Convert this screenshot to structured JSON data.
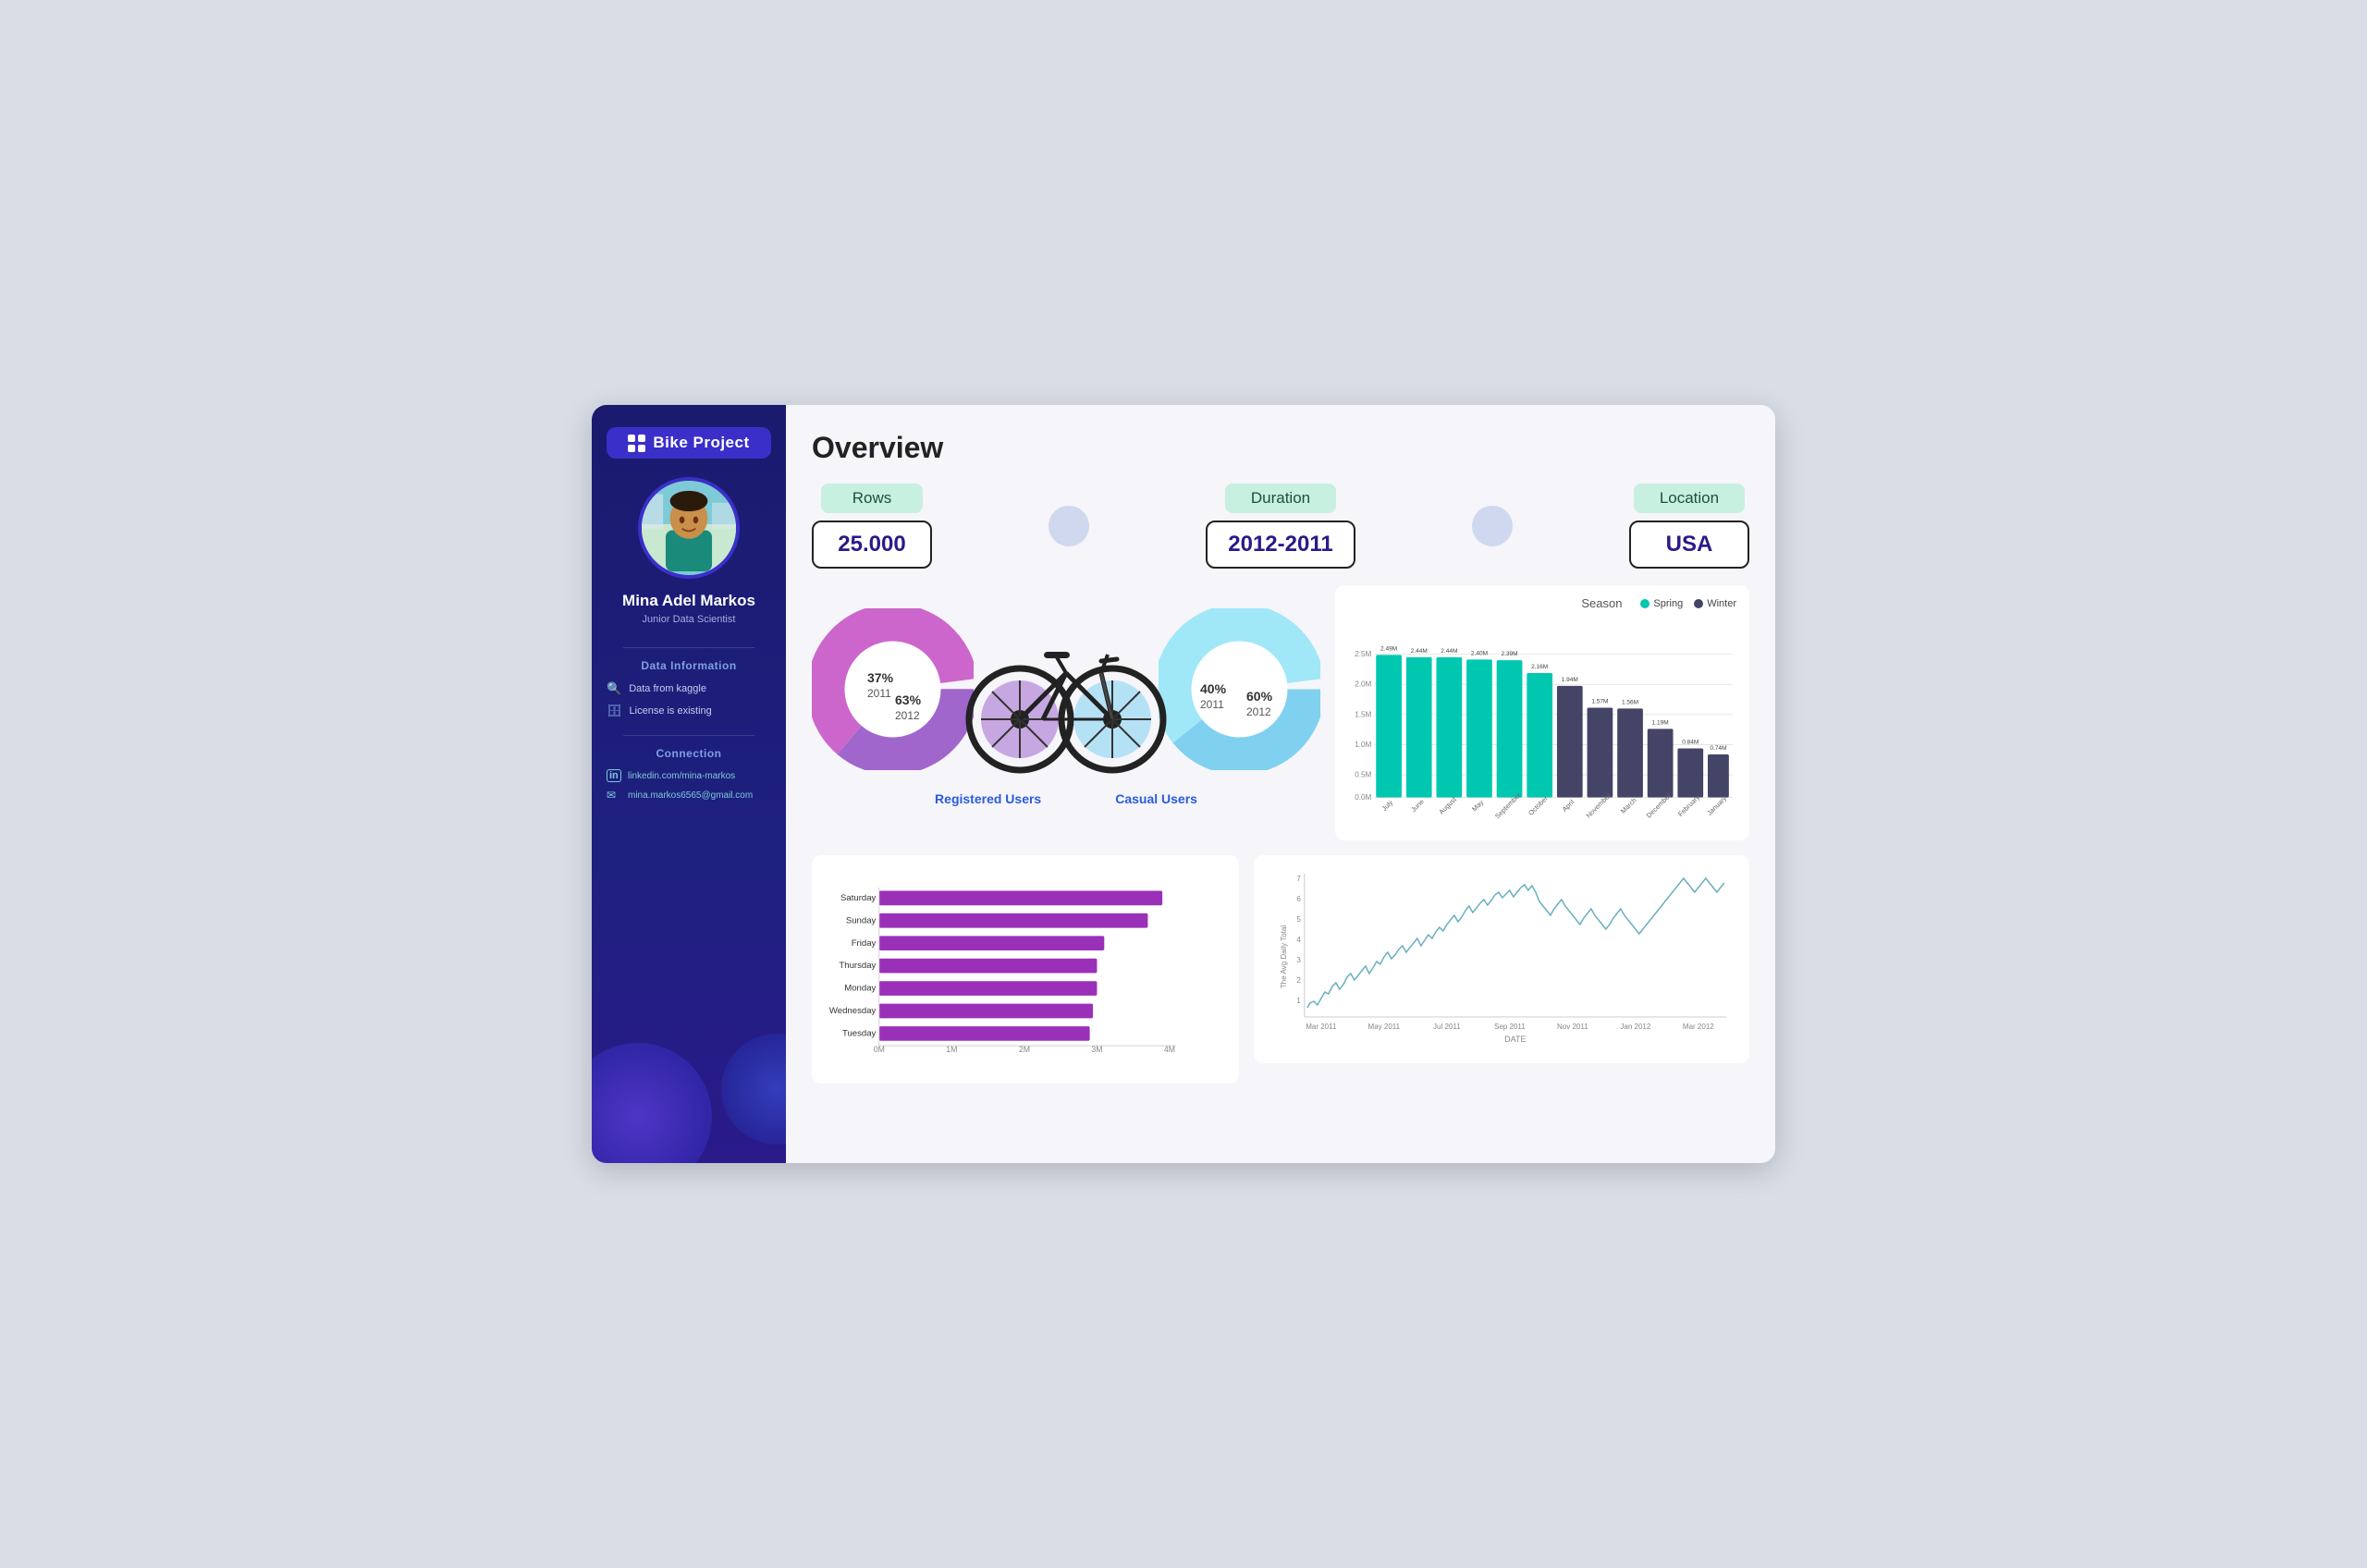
{
  "sidebar": {
    "logo_text": "Bike Project",
    "user_name": "Mina Adel Markos",
    "user_title": "Junior Data Scientist",
    "section_data": "Data Information",
    "items": [
      {
        "icon": "🔍",
        "label": "Data from kaggle"
      },
      {
        "icon": "🗄",
        "label": "License is existing"
      }
    ],
    "section_connection": "Connection",
    "connections": [
      {
        "icon": "in",
        "label": "linkedin.com/mina-markos"
      },
      {
        "icon": "✉",
        "label": "mina.markos6565@gmail.com"
      }
    ]
  },
  "main": {
    "title": "Overview",
    "cards": {
      "rows_label": "Rows",
      "rows_value": "25.000",
      "duration_label": "Duration",
      "duration_value": "2012-2011",
      "location_label": "Location",
      "location_value": "USA"
    },
    "donut_registered": {
      "label": "Registered Users",
      "pct_2011": "37%",
      "pct_2012": "63%",
      "year_2011": "2011",
      "year_2012": "2012",
      "color_2011": "#a066cc",
      "color_2012": "#cc66cc"
    },
    "donut_casual": {
      "label": "Casual Users",
      "pct_2011": "40%",
      "pct_2012": "60%",
      "year_2011": "2011",
      "year_2012": "2012",
      "color_2011": "#80d0f0",
      "color_2012": "#a0e8f8"
    },
    "bar_chart": {
      "title": "Season",
      "legend": [
        {
          "label": "Spring",
          "color": "#00c8b0"
        },
        {
          "label": "Winter",
          "color": "#444466"
        }
      ],
      "months": [
        "July",
        "June",
        "August",
        "May",
        "September",
        "October",
        "April",
        "November",
        "March",
        "December",
        "February",
        "January"
      ],
      "spring": [
        2490000,
        2440000,
        2440000,
        2400000,
        2390000,
        2160000,
        1940000,
        1570000,
        1560000,
        1190000,
        840000,
        740000
      ],
      "winter": [
        0,
        0,
        0,
        0,
        0,
        0,
        0,
        0,
        0,
        0,
        0,
        0
      ],
      "labels": [
        "2.49M",
        "2.44M",
        "2.44M",
        "2.40M",
        "2.39M",
        "2.16M",
        "1.94M",
        "1.57M",
        "1.56M",
        "1.19M",
        "0.84M",
        "0.74M"
      ]
    },
    "hbar_chart": {
      "days": [
        "Saturday",
        "Sunday",
        "Friday",
        "Thursday",
        "Monday",
        "Wednesday",
        "Tuesday"
      ],
      "values": [
        3900000,
        3700000,
        3100000,
        3000000,
        3000000,
        2950000,
        2900000
      ],
      "x_labels": [
        "0M",
        "1M",
        "2M",
        "3M",
        "4M"
      ],
      "color": "#9b30b8"
    },
    "line_chart": {
      "y_label": "The Avg Daily Total",
      "x_label": "DATE",
      "x_ticks": [
        "Mar 2011",
        "May 2011",
        "Jul 2011",
        "Sep 2011",
        "Nov 2011",
        "Jan 2012",
        "Mar 2012"
      ]
    }
  }
}
